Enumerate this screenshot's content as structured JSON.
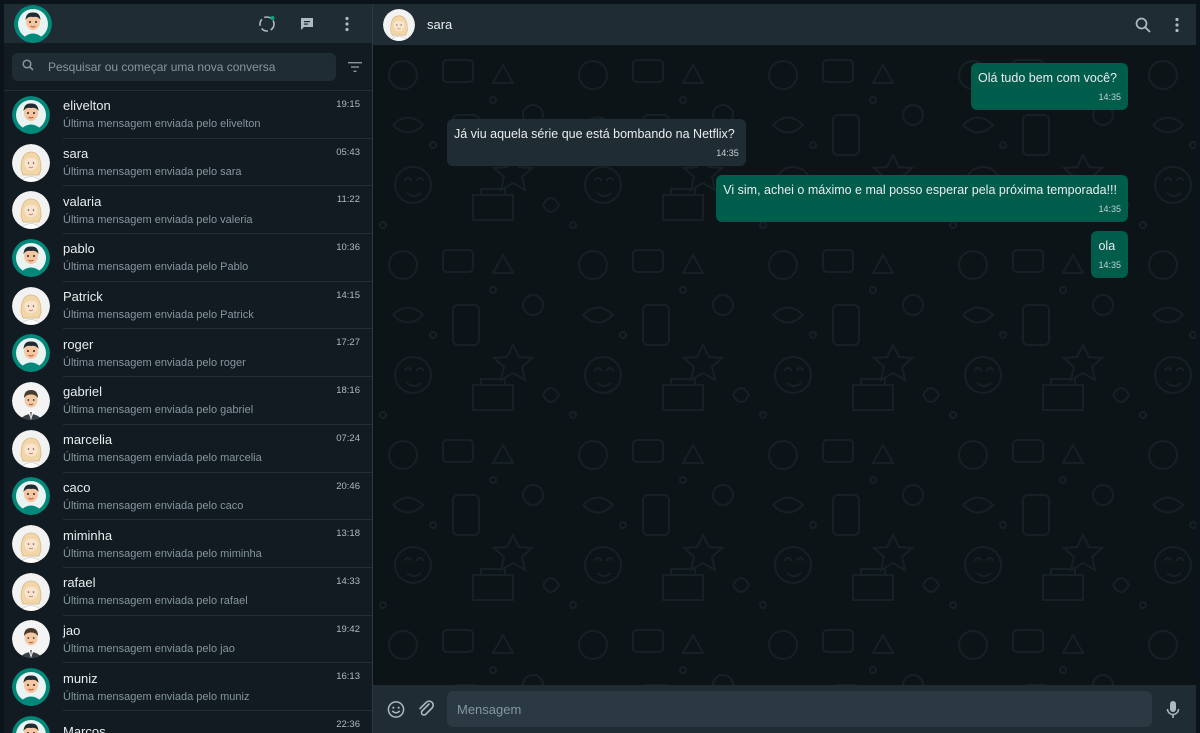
{
  "sidebar": {
    "search": {
      "placeholder": "Pesquisar ou começar uma nova conversa",
      "value": ""
    },
    "chats": [
      {
        "name": "elivelton",
        "time": "19:15",
        "last": "Última mensagem enviada pelo elivelton",
        "avatar": "male-teal"
      },
      {
        "name": "sara",
        "time": "05:43",
        "last": "Última mensagem enviada pelo sara",
        "avatar": "female"
      },
      {
        "name": "valaria",
        "time": "11:22",
        "last": "Última mensagem enviada pelo valeria",
        "avatar": "female"
      },
      {
        "name": "pablo",
        "time": "10:36",
        "last": "Última mensagem enviada pelo Pablo",
        "avatar": "male-teal"
      },
      {
        "name": "Patrick",
        "time": "14:15",
        "last": "Última mensagem enviada pelo Patrick",
        "avatar": "female"
      },
      {
        "name": "roger",
        "time": "17:27",
        "last": "Última mensagem enviada pelo roger",
        "avatar": "male-teal"
      },
      {
        "name": "gabriel",
        "time": "18:16",
        "last": "Última mensagem enviada pelo gabriel",
        "avatar": "male-suit"
      },
      {
        "name": "marcelia",
        "time": "07:24",
        "last": "Última mensagem enviada pelo marcelia",
        "avatar": "female"
      },
      {
        "name": "caco",
        "time": "20:46",
        "last": "Última mensagem enviada pelo caco",
        "avatar": "male-teal"
      },
      {
        "name": "miminha",
        "time": "13:18",
        "last": "Última mensagem enviada pelo miminha",
        "avatar": "female"
      },
      {
        "name": "rafael",
        "time": "14:33",
        "last": "Última mensagem enviada pelo rafael",
        "avatar": "female"
      },
      {
        "name": "jao",
        "time": "19:42",
        "last": "Última mensagem enviada pelo jao",
        "avatar": "male-suit"
      },
      {
        "name": "muniz",
        "time": "16:13",
        "last": "Última mensagem enviada pelo muniz",
        "avatar": "male-teal"
      },
      {
        "name": "Marcos",
        "time": "22:36",
        "last": "",
        "avatar": "male-teal"
      }
    ]
  },
  "chat": {
    "contact_name": "sara",
    "messages": [
      {
        "dir": "out",
        "text": "Olá tudo bem com você?",
        "time": "14:35"
      },
      {
        "dir": "in",
        "text": "Já viu aquela série que está bombando na Netflix?",
        "time": "14:35"
      },
      {
        "dir": "out",
        "text": "Vi sim, achei o máximo e mal posso esperar pela próxima temporada!!!",
        "time": "14:35"
      },
      {
        "dir": "out",
        "text": "ola",
        "time": "14:35"
      }
    ],
    "composer": {
      "placeholder": "Mensagem",
      "value": ""
    }
  },
  "colors": {
    "outgoing_bubble": "#005c4b",
    "incoming_bubble": "#202c33",
    "header_bg": "#202c33",
    "accent_teal": "#00a884"
  },
  "icons": [
    "status-icon",
    "new-chat-icon",
    "menu-icon",
    "search-icon",
    "filter-icon",
    "emoji-icon",
    "attach-icon",
    "mic-icon"
  ]
}
